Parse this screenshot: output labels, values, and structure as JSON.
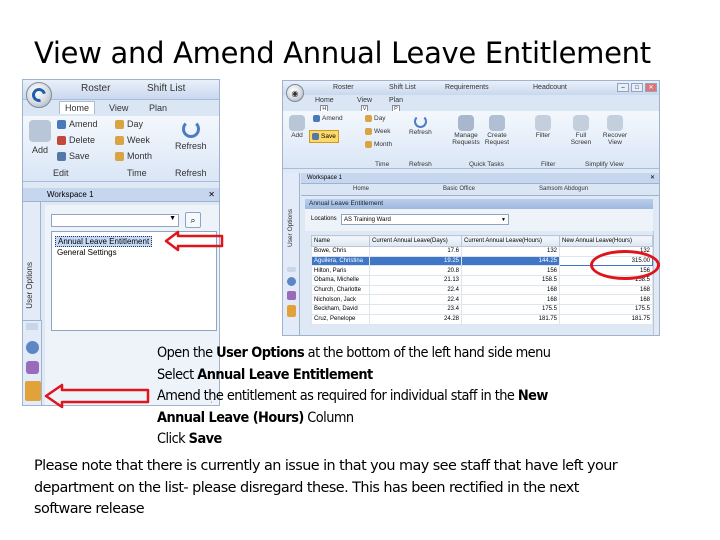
{
  "slide": {
    "title": "View and Amend Annual Leave Entitlement"
  },
  "left_screenshot": {
    "tabs": [
      "Roster",
      "Shift List"
    ],
    "menu": [
      "Home",
      "View",
      "Plan"
    ],
    "ribbon": {
      "add": "Add",
      "amend": "Amend",
      "delete": "Delete",
      "save": "Save",
      "day": "Day",
      "week": "Week",
      "month": "Month",
      "refresh": "Refresh",
      "group_edit": "Edit",
      "group_time": "Time",
      "group_refresh": "Refresh"
    },
    "workspace_tab": "Workspace 1",
    "user_options_label": "User Options",
    "combo_value": "",
    "list_items": [
      "Annual Leave Entitlement",
      "General Settings"
    ]
  },
  "right_screenshot": {
    "tabs": [
      "Roster",
      "Shift List",
      "Requirements",
      "Headcount"
    ],
    "menu": [
      {
        "label": "Home",
        "key": "H"
      },
      {
        "label": "View",
        "key": "V"
      },
      {
        "label": "Plan",
        "key": "P"
      }
    ],
    "ribbon": {
      "add": "Add",
      "amend": "Amend",
      "save": "Save",
      "day": "Day",
      "week": "Week",
      "month": "Month",
      "refresh": "Refresh",
      "manage_requests": "Manage Requests",
      "create_request": "Create Request",
      "filter": "Filter",
      "full_screen": "Full Screen",
      "recover_view": "Recover View",
      "group_time": "Time",
      "group_refresh": "Refresh",
      "group_quick_tasks": "Quick Tasks",
      "group_filter": "Filter",
      "group_simplify_view": "Simplify View"
    },
    "workspace_tab": "Workspace 1",
    "nav": [
      "Home",
      "Basic Office",
      "Samsom Abdogun"
    ],
    "user_options_label": "User Options",
    "panel_title": "Annual Leave Entitlement",
    "locations_label": "Locations",
    "location_value": "AS Training Ward",
    "grid": {
      "columns": [
        "Name",
        "Current Annual Leave(Days)",
        "Current Annual Leave(Hours)",
        "New Annual Leave(Hours)"
      ],
      "rows": [
        [
          "Bowe, Chris",
          "17.6",
          "132",
          "132"
        ],
        [
          "Aguilera, Christina",
          "19.25",
          "144.25",
          "315.00"
        ],
        [
          "Hilton, Paris",
          "20.8",
          "156",
          "156"
        ],
        [
          "Obama, Michelle",
          "21.13",
          "158.5",
          "158.5"
        ],
        [
          "Church, Charlotte",
          "22.4",
          "168",
          "168"
        ],
        [
          "Nicholson, Jack",
          "22.4",
          "168",
          "168"
        ],
        [
          "Beckham, David",
          "23.4",
          "175.5",
          "175.5"
        ],
        [
          "Cruz, Penelope",
          "24.28",
          "181.75",
          "181.75"
        ]
      ],
      "selected_row": 1
    }
  },
  "instructions": [
    [
      {
        "t": "Open the ",
        "b": false
      },
      {
        "t": "User Options",
        "b": true
      },
      {
        "t": " at the bottom of the left hand side menu",
        "b": false
      }
    ],
    [
      {
        "t": "Select ",
        "b": false
      },
      {
        "t": "Annual Leave Entitlement",
        "b": true
      }
    ],
    [
      {
        "t": "Amend the entitlement as required for individual staff in the ",
        "b": false
      },
      {
        "t": "New",
        "b": true
      }
    ],
    [
      {
        "t": "Annual Leave (Hours)",
        "b": true
      },
      {
        "t": " Column",
        "b": false
      }
    ],
    [
      {
        "t": "Click ",
        "b": false
      },
      {
        "t": "Save",
        "b": true
      }
    ]
  ],
  "note_lines": [
    "Please note that there is currently an issue in that you may see staff that have left your",
    "department on the list- please disregard these. This has been rectified in the next",
    "software release"
  ],
  "colors": {
    "highlight_red": "#e0141b",
    "selection_blue": "#3f76c6",
    "save_highlight": "#ffd86a"
  }
}
